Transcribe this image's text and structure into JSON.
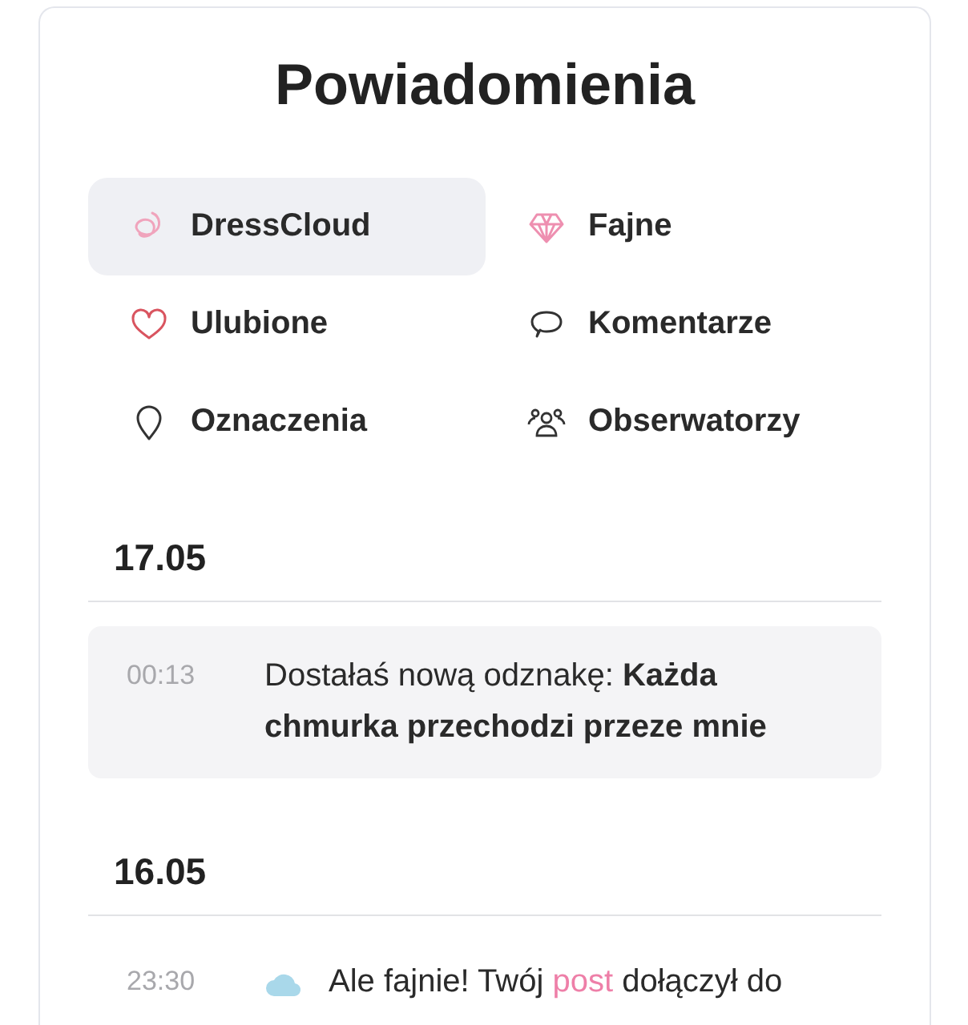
{
  "title": "Powiadomienia",
  "filters": [
    {
      "label": "DressCloud",
      "selected": true
    },
    {
      "label": "Fajne",
      "selected": false
    },
    {
      "label": "Ulubione",
      "selected": false
    },
    {
      "label": "Komentarze",
      "selected": false
    },
    {
      "label": "Oznaczenia",
      "selected": false
    },
    {
      "label": "Obserwatorzy",
      "selected": false
    }
  ],
  "days": [
    {
      "date": "17.05",
      "notifications": [
        {
          "time": "00:13",
          "kind": "badge",
          "parts": [
            {
              "kind": "text",
              "text": "Dostałaś nową odznakę: "
            },
            {
              "kind": "bold",
              "text": "Każda chmurka przechodzi przeze mnie"
            }
          ]
        }
      ]
    },
    {
      "date": "16.05",
      "notifications": [
        {
          "time": "23:30",
          "kind": "post",
          "parts": [
            {
              "kind": "text",
              "text": "Ale fajnie! Twój "
            },
            {
              "kind": "link",
              "text": "post"
            },
            {
              "kind": "text",
              "text": " dołączył do"
            }
          ]
        }
      ]
    }
  ]
}
